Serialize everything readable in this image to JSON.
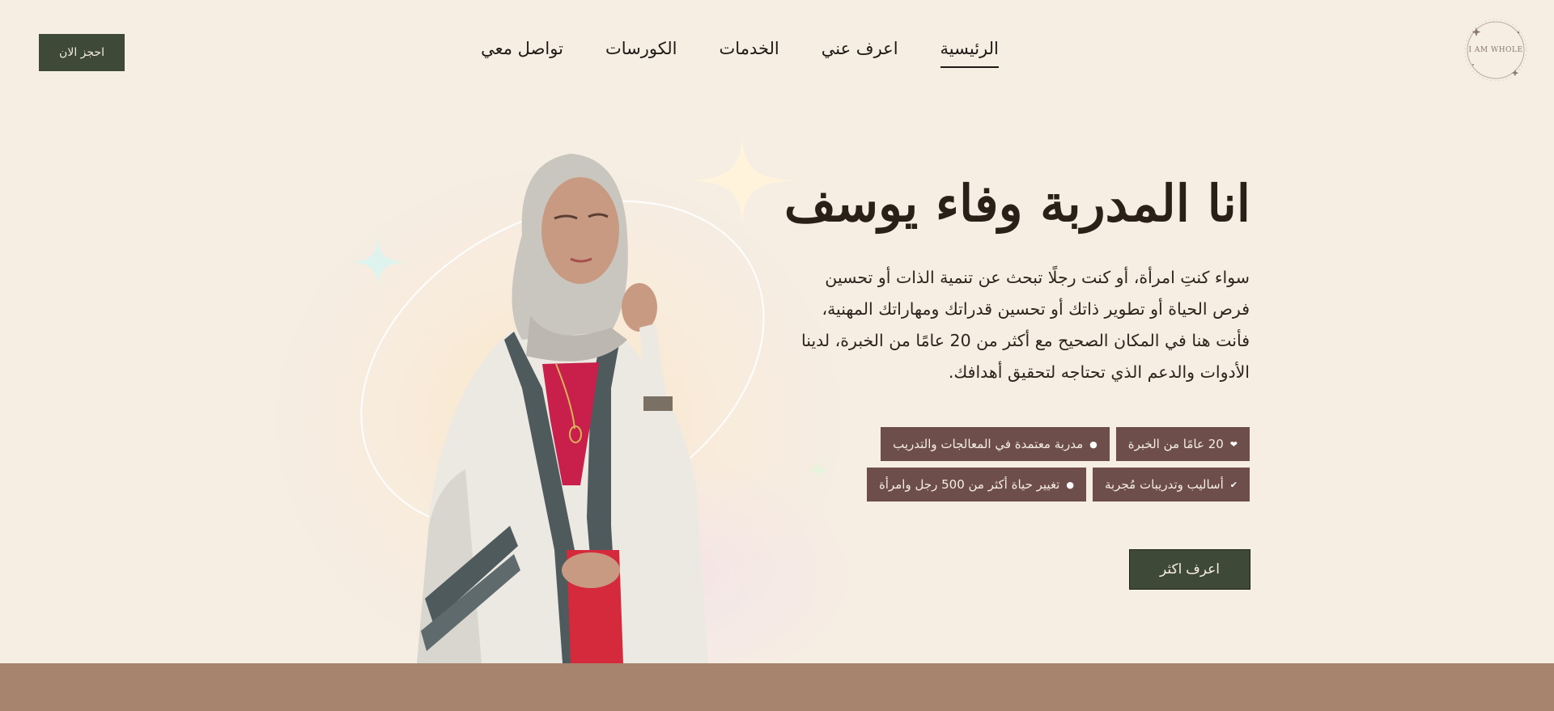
{
  "logo": {
    "text": "I AM WHOLE",
    "icon": "circle-logo-icon"
  },
  "nav": {
    "items": [
      {
        "label": "الرئيسية",
        "active": true
      },
      {
        "label": "اعرف عني",
        "active": false
      },
      {
        "label": "الخدمات",
        "active": false
      },
      {
        "label": "الكورسات",
        "active": false
      },
      {
        "label": "تواصل معي",
        "active": false
      }
    ]
  },
  "header": {
    "book_label": "احجز الان"
  },
  "hero": {
    "title": "انا المدربة وفاء يوسف",
    "description": "سواء كنتِ امرأة، أو كنت رجلًا تبحث عن تنمية الذات أو تحسين فرص الحياة أو تطوير ذاتك أو تحسين قدراتك ومهاراتك المهنية، فأنت هنا في المكان الصحيح مع أكثر من 20 عامًا من الخبرة، لدينا الأدوات والدعم الذي تحتاجه لتحقيق أهدافك.",
    "badges": [
      {
        "label": "20 عامًا من الخبرة",
        "icon": "heart-icon"
      },
      {
        "label": "مدربة معتمدة في المعالجات والتدريب",
        "icon": "dot-icon"
      },
      {
        "label": "أساليب وتدريبات مُجربة",
        "icon": "check-icon"
      },
      {
        "label": "تغيير حياة أكثر من 500 رجل وامرأة",
        "icon": "dot-icon"
      }
    ],
    "cta_label": "اعرف اكثر"
  },
  "colors": {
    "background": "#f6ede3",
    "primary_button": "#3e4a37",
    "badge": "#6d4e4a",
    "footer_bar": "#a6846e"
  }
}
